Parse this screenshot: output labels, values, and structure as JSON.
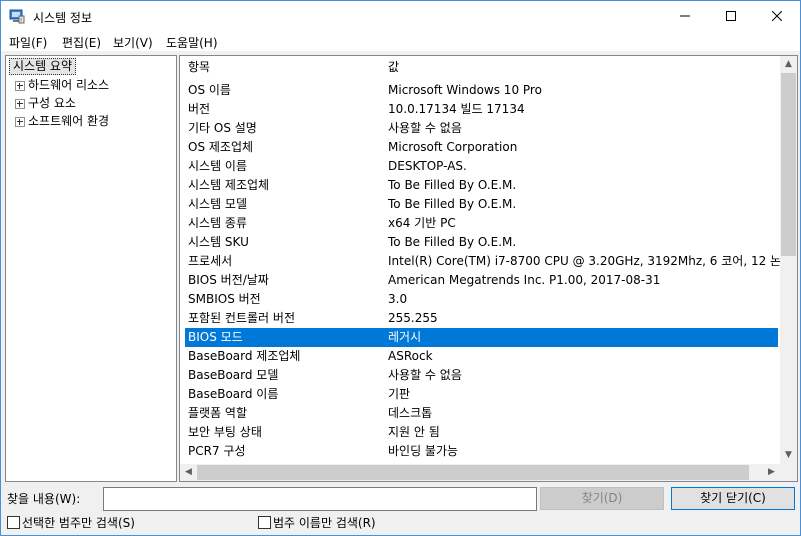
{
  "window": {
    "title": "시스템 정보"
  },
  "menu": [
    "파일(F)",
    "편집(E)",
    "보기(V)",
    "도움말(H)"
  ],
  "tree": {
    "root": "시스템 요약",
    "children": [
      "하드웨어 리소스",
      "구성 요소",
      "소프트웨어 환경"
    ]
  },
  "list": {
    "headers": {
      "item": "항목",
      "value": "값"
    },
    "rows": [
      [
        "OS 이름",
        "Microsoft Windows 10 Pro"
      ],
      [
        "버전",
        "10.0.17134 빌드 17134"
      ],
      [
        "기타 OS 설명",
        "사용할 수 없음"
      ],
      [
        "OS 제조업체",
        "Microsoft Corporation"
      ],
      [
        "시스템 이름",
        "DESKTOP-AS."
      ],
      [
        "시스템 제조업체",
        "To Be Filled By O.E.M."
      ],
      [
        "시스템 모델",
        "To Be Filled By O.E.M."
      ],
      [
        "시스템 종류",
        "x64 기반 PC"
      ],
      [
        "시스템 SKU",
        "To Be Filled By O.E.M."
      ],
      [
        "프로세서",
        "Intel(R) Core(TM) i7-8700 CPU @ 3.20GHz, 3192Mhz, 6 코어, 12 논리 프"
      ],
      [
        "BIOS 버전/날짜",
        "American Megatrends Inc. P1.00, 2017-08-31"
      ],
      [
        "SMBIOS 버전",
        "3.0"
      ],
      [
        "포함된 컨트롤러 버전",
        "255.255"
      ],
      [
        "BIOS 모드",
        "레거시"
      ],
      [
        "BaseBoard 제조업체",
        "ASRock"
      ],
      [
        "BaseBoard 모델",
        "사용할 수 없음"
      ],
      [
        "BaseBoard 이름",
        "기판"
      ],
      [
        "플랫폼 역할",
        "데스크톱"
      ],
      [
        "보안 부팅 상태",
        "지원 안 됨"
      ],
      [
        "PCR7 구성",
        "바인딩 불가능"
      ]
    ],
    "selected_index": 13
  },
  "find": {
    "label": "찾을 내용(W):",
    "value": "",
    "find_button": "찾기(D)",
    "close_find_button": "찾기 닫기(C)",
    "checkbox_selected_category": "선택한 범주만 검색(S)",
    "checkbox_category_names": "범주 이름만 검색(R)"
  },
  "colors": {
    "selection": "#0078d7",
    "accent_border": "#4a90d9"
  }
}
